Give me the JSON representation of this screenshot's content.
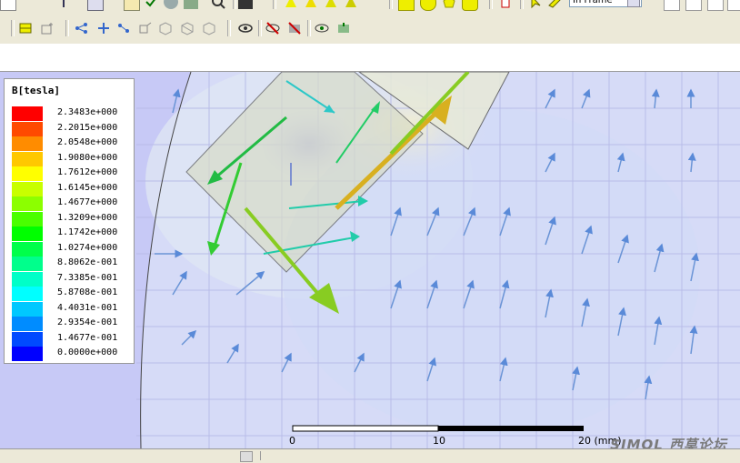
{
  "toolbar": {
    "frame_select_value": "In Frame",
    "icons_row1": [
      "open-icon",
      "pin-icon",
      "select-icon",
      "check-icon",
      "settings-icon",
      "zoom-icon",
      "marker-icon",
      "highlight-icon",
      "yellow-square-icon",
      "circle-icon",
      "pentagon-icon",
      "diamond-icon",
      "cylinder-icon",
      "pointer-icon",
      "paint-icon"
    ],
    "icons_row2": [
      "box-icon",
      "split-icon",
      "nodes-icon",
      "nodes2-icon",
      "nodes3-icon",
      "nodes4-icon",
      "cube-icon",
      "mesh-icon",
      "link-icon",
      "eye-icon",
      "eye-off-icon",
      "eye-hide-icon",
      "eye-show-icon",
      "cube-show-icon"
    ]
  },
  "legend": {
    "title": "B[tesla]",
    "entries": [
      {
        "label": "2.3483e+000",
        "color": "#ff0000"
      },
      {
        "label": "2.2015e+000",
        "color": "#ff4a00"
      },
      {
        "label": "2.0548e+000",
        "color": "#ff8c00"
      },
      {
        "label": "1.9080e+000",
        "color": "#ffc800"
      },
      {
        "label": "1.7612e+000",
        "color": "#ffff00"
      },
      {
        "label": "1.6145e+000",
        "color": "#c8ff00"
      },
      {
        "label": "1.4677e+000",
        "color": "#8cff00"
      },
      {
        "label": "1.3209e+000",
        "color": "#4aff00"
      },
      {
        "label": "1.1742e+000",
        "color": "#00ff00"
      },
      {
        "label": "1.0274e+000",
        "color": "#00ff4a"
      },
      {
        "label": "8.8062e-001",
        "color": "#00ff8c"
      },
      {
        "label": "7.3385e-001",
        "color": "#00ffc8"
      },
      {
        "label": "5.8708e-001",
        "color": "#00ffff"
      },
      {
        "label": "4.4031e-001",
        "color": "#00c8ff"
      },
      {
        "label": "2.9354e-001",
        "color": "#008cff"
      },
      {
        "label": "1.4677e-001",
        "color": "#004aff"
      },
      {
        "label": "0.0000e+000",
        "color": "#0000ff"
      }
    ]
  },
  "scale": {
    "tick0": "0",
    "tick1": "10",
    "tick2": "20 (mm)"
  },
  "watermark": "SIMOL 西莫论坛"
}
